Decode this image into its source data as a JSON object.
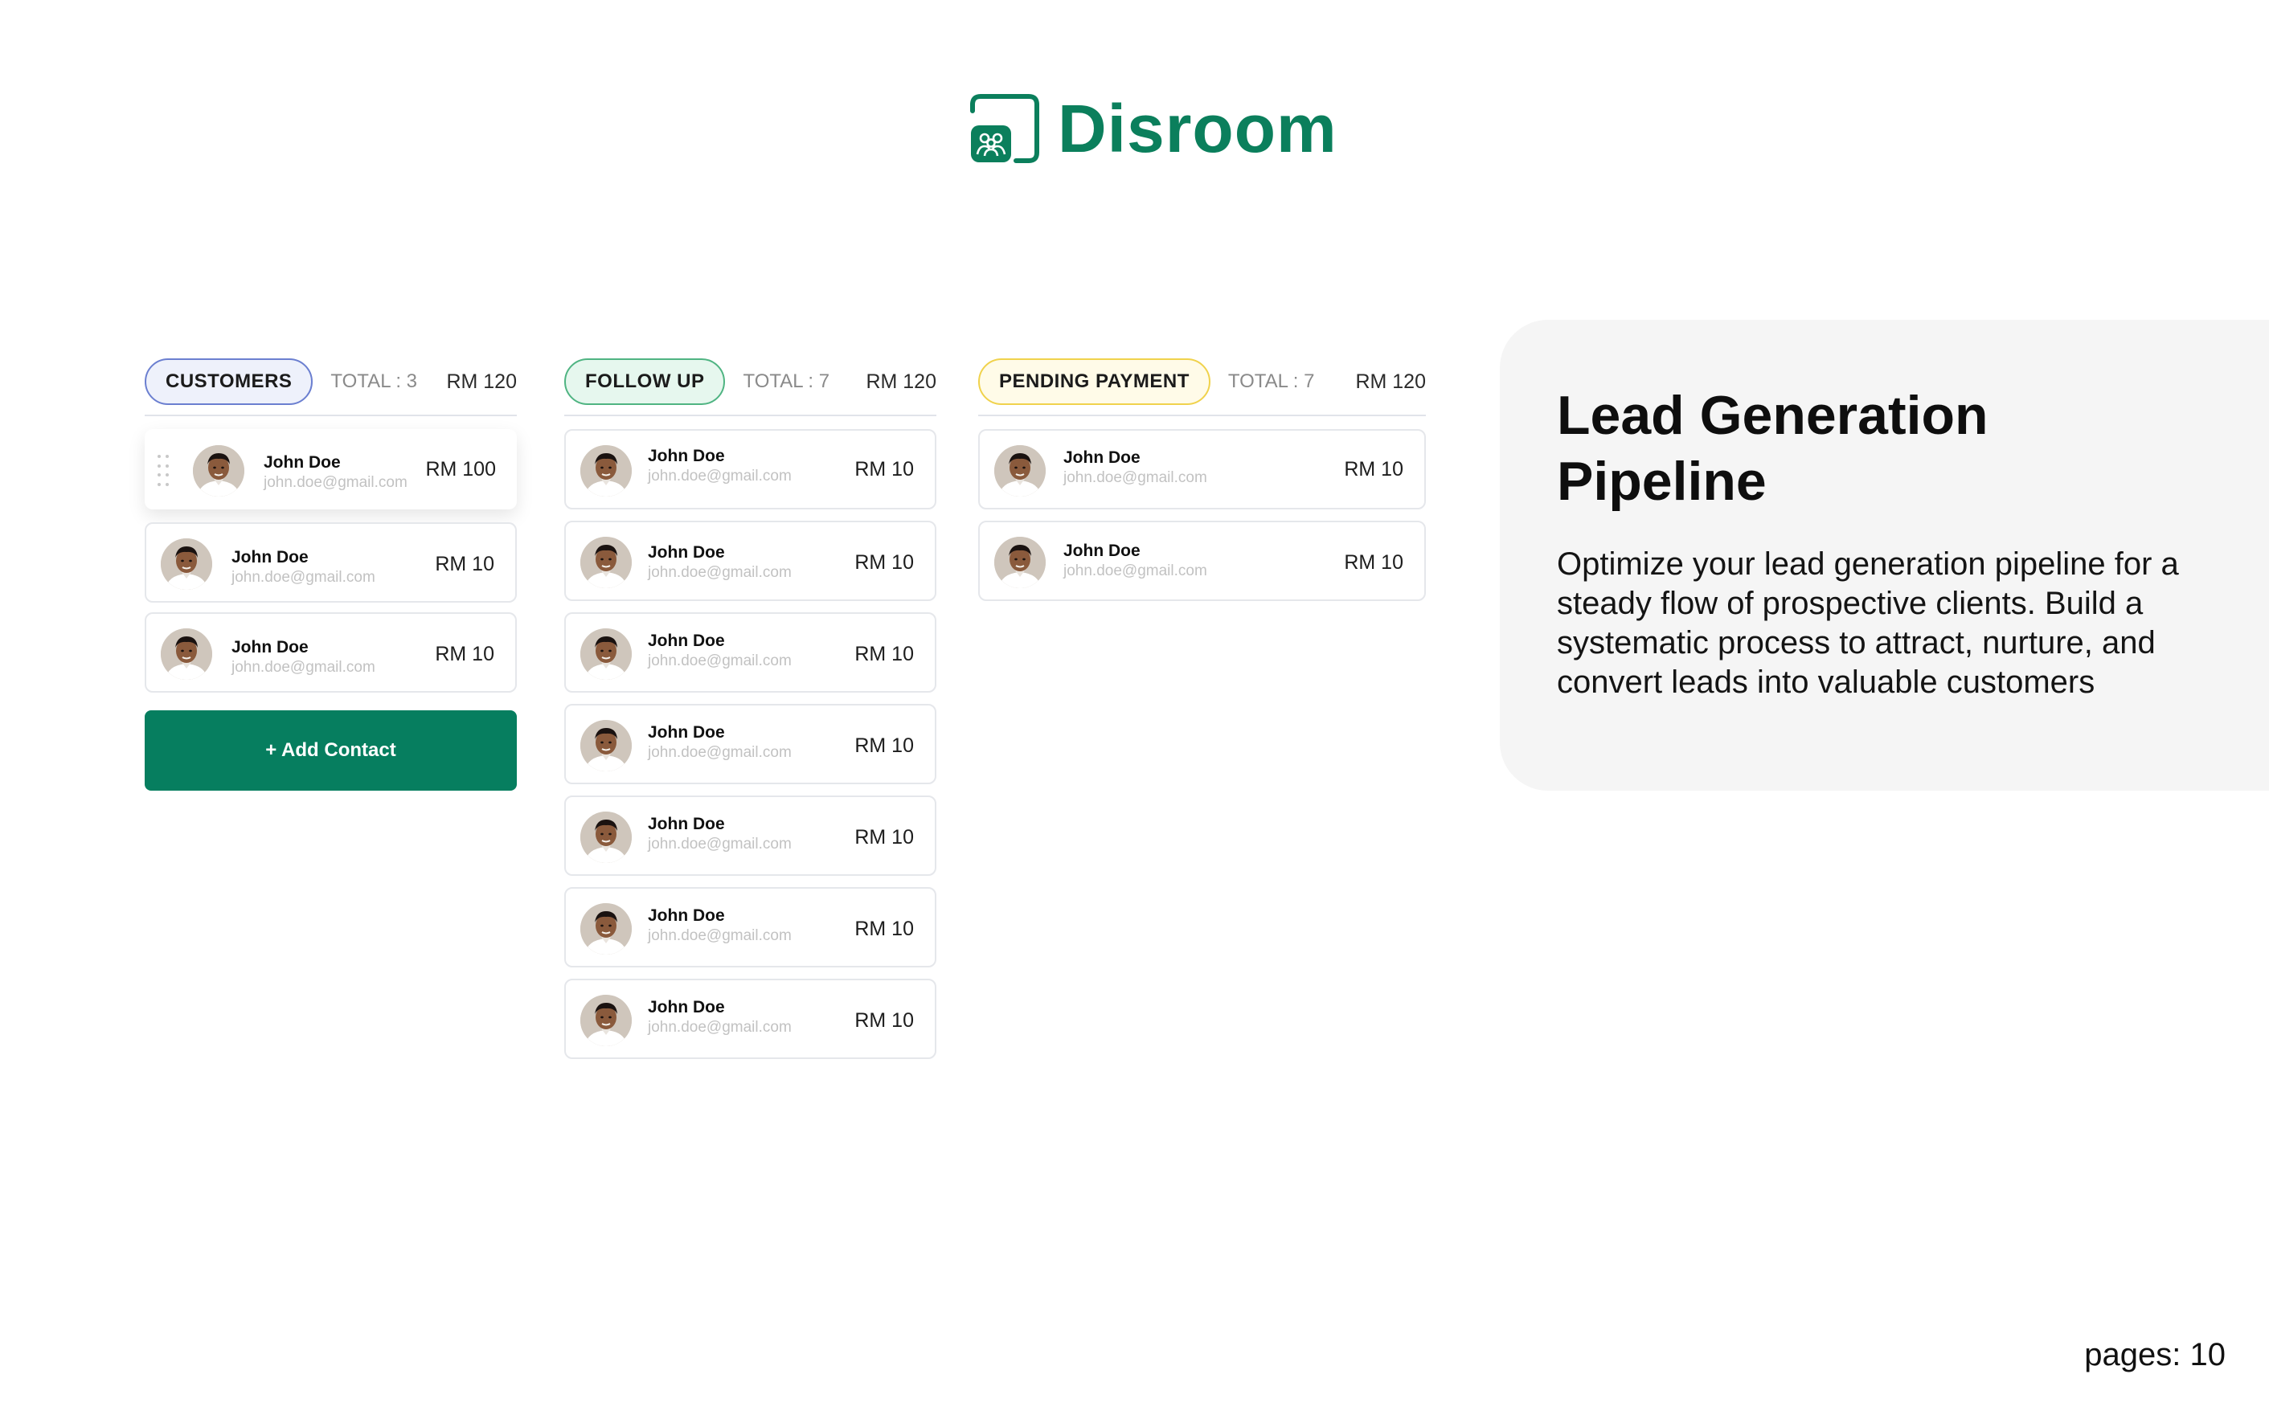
{
  "brand": {
    "name": "Disroom",
    "color": "#0b7f5c"
  },
  "columns": [
    {
      "label": "CUSTOMERS",
      "total": "TOTAL : 3",
      "amount": "RM 120",
      "cards": [
        {
          "name": "John Doe",
          "email": "john.doe@gmail.com",
          "amount": "RM 100"
        },
        {
          "name": "John Doe",
          "email": "john.doe@gmail.com",
          "amount": "RM 10"
        },
        {
          "name": "John Doe",
          "email": "john.doe@gmail.com",
          "amount": "RM 10"
        }
      ],
      "add_label": "+ Add Contact"
    },
    {
      "label": "FOLLOW UP",
      "total": "TOTAL : 7",
      "amount": "RM 120",
      "cards": [
        {
          "name": "John Doe",
          "email": "john.doe@gmail.com",
          "amount": "RM 10"
        },
        {
          "name": "John Doe",
          "email": "john.doe@gmail.com",
          "amount": "RM 10"
        },
        {
          "name": "John Doe",
          "email": "john.doe@gmail.com",
          "amount": "RM 10"
        },
        {
          "name": "John Doe",
          "email": "john.doe@gmail.com",
          "amount": "RM 10"
        },
        {
          "name": "John Doe",
          "email": "john.doe@gmail.com",
          "amount": "RM 10"
        },
        {
          "name": "John Doe",
          "email": "john.doe@gmail.com",
          "amount": "RM 10"
        },
        {
          "name": "John Doe",
          "email": "john.doe@gmail.com",
          "amount": "RM 10"
        }
      ]
    },
    {
      "label": "PENDING PAYMENT",
      "total": "TOTAL : 7",
      "amount": "RM 120",
      "cards": [
        {
          "name": "John Doe",
          "email": "john.doe@gmail.com",
          "amount": "RM 10"
        },
        {
          "name": "John Doe",
          "email": "john.doe@gmail.com",
          "amount": "RM 10"
        }
      ]
    }
  ],
  "panel": {
    "title": "Lead Generation Pipeline",
    "body": "Optimize your lead generation pipeline for a steady flow of prospective clients. Build a systematic process to attract, nurture, and convert leads into valuable customers"
  },
  "footer": {
    "pages": "pages: 10"
  },
  "icons": {
    "logo": "team-room-icon",
    "avatar": "user-avatar-icon",
    "drag": "drag-handle-icon"
  },
  "colors": {
    "customers_accent": "#6b7fd0",
    "follow_accent": "#4fb482",
    "pending_accent": "#f0d24c",
    "button": "#067e5f"
  }
}
